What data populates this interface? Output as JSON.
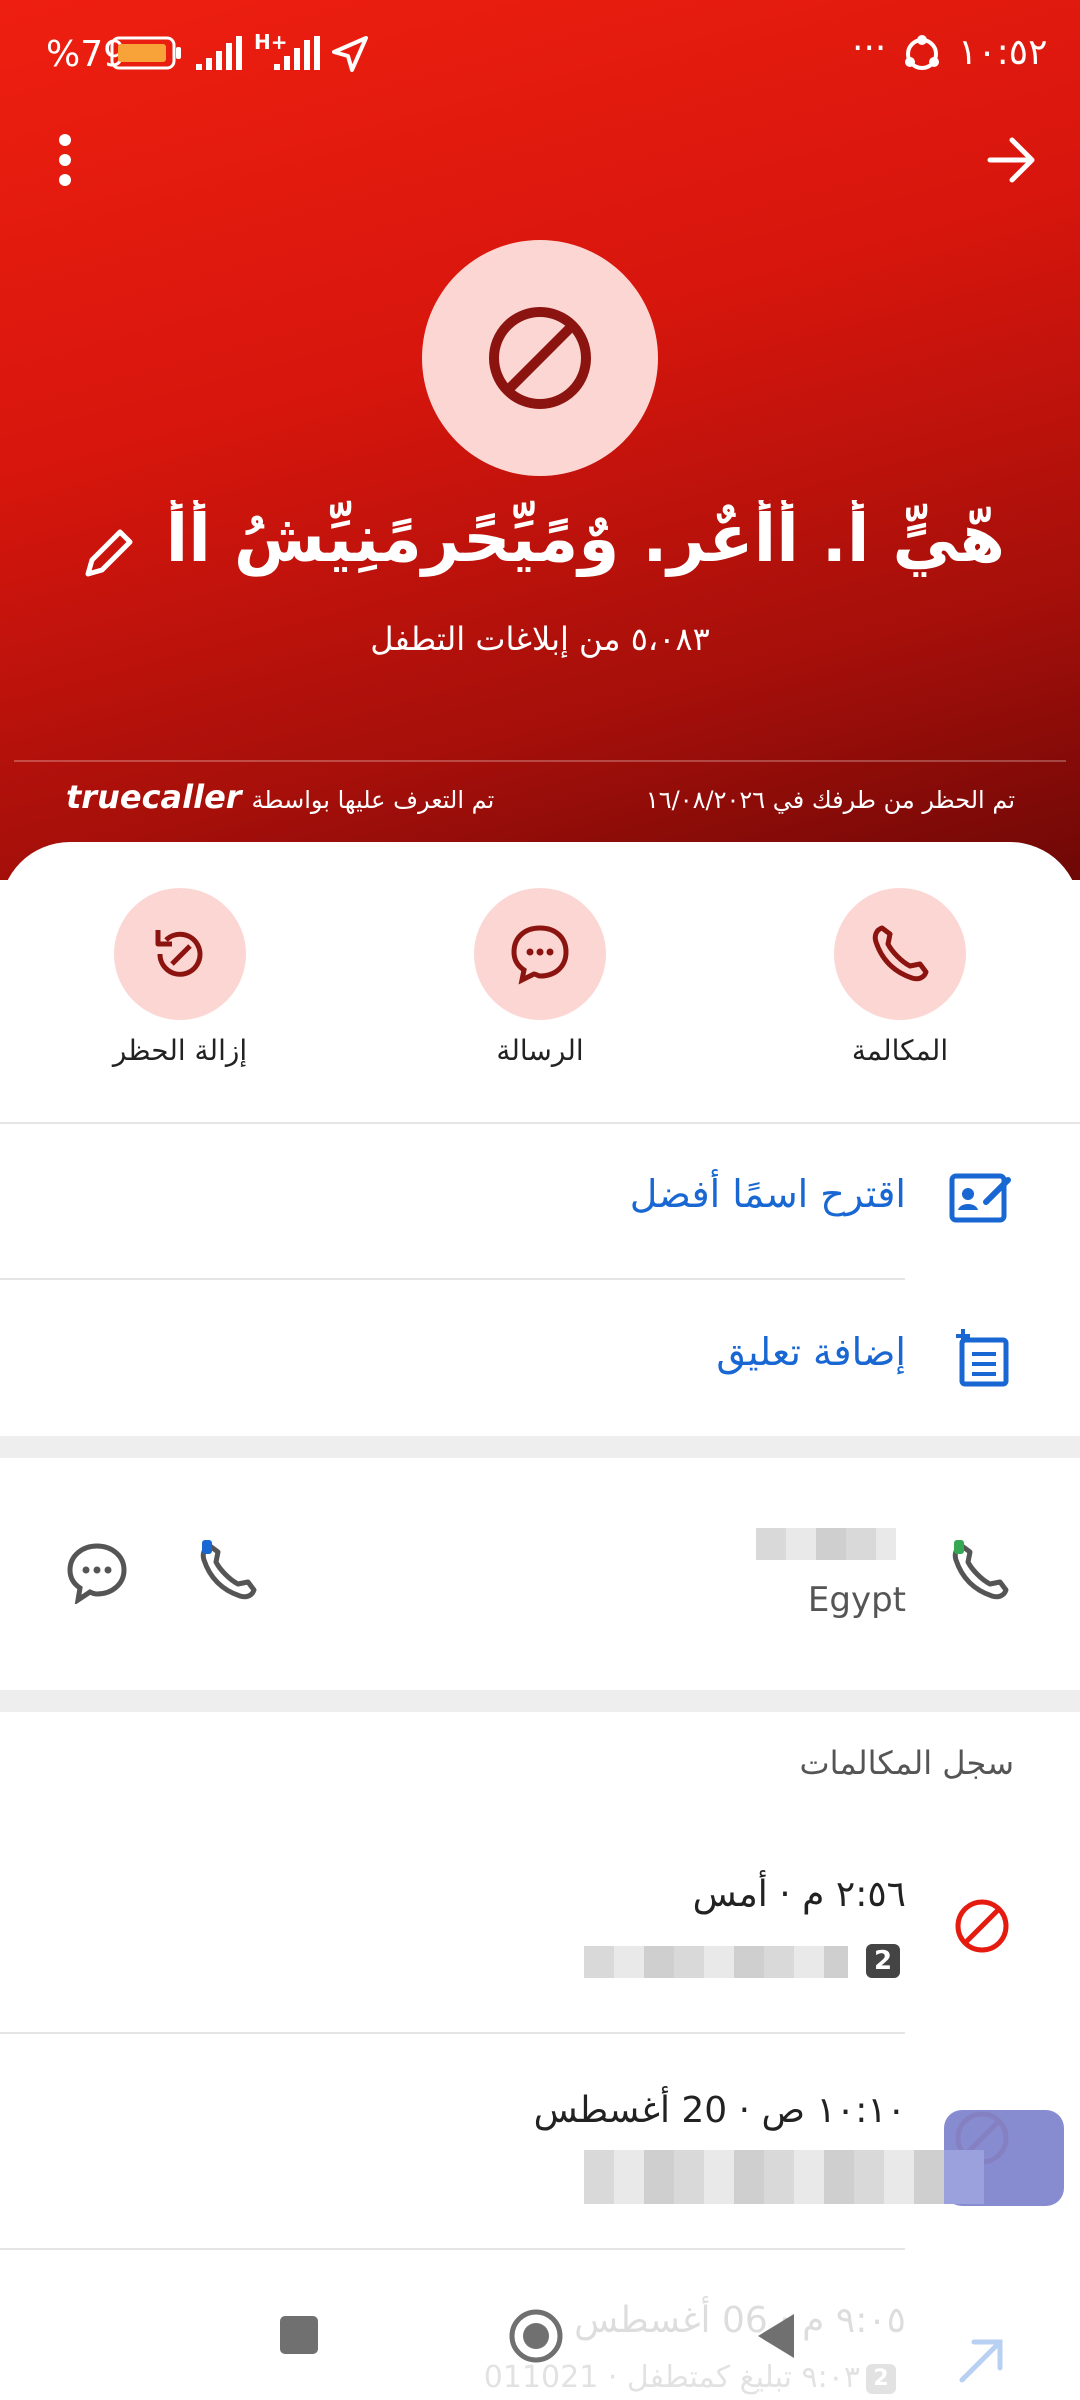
{
  "status_bar": {
    "battery_pct": "%79",
    "network": "H+",
    "time": "١٠:٥٢",
    "more": "···"
  },
  "header": {
    "contact_name": "هّيٍّ أ. أأعٌر. وٌمًيِّحًرمًنِيِّشُ أأ",
    "spam_reports": "٥،٠٨٣ من إبلاغات التطفل",
    "blocked_text": "تم الحظر من طرفك في ١٦/٠٨/٢٠٢٦",
    "identified_by": "تم التعرف عليها بواسطة",
    "brand": "truecaller"
  },
  "actions": [
    {
      "label": "المكالمة",
      "icon": "phone-icon"
    },
    {
      "label": "الرسالة",
      "icon": "message-icon"
    },
    {
      "label": "إزالة الحظر",
      "icon": "unblock-icon"
    }
  ],
  "options": {
    "suggest_name": "اقترح اسمًا أفضل",
    "add_comment": "إضافة تعليق"
  },
  "number": {
    "country": "Egypt"
  },
  "call_log": {
    "title": "سجل المكالمات",
    "entries": [
      {
        "time": "٢:٥٦ م · أمس",
        "sim": "2"
      },
      {
        "time": "١٠:١٠ ص · 20 أغسطس",
        "sim": ""
      },
      {
        "time": "٩:٠٥ م · 06 أغسطس",
        "sub": "٩:٠٣ تبليغ كمتطفل · 011021",
        "sim": "2"
      }
    ]
  },
  "colors": {
    "brand_red": "#e51b0f",
    "accent_pink": "#fcd6d2",
    "icon_dark_red": "#8b1410",
    "link_blue": "#1967d2"
  }
}
